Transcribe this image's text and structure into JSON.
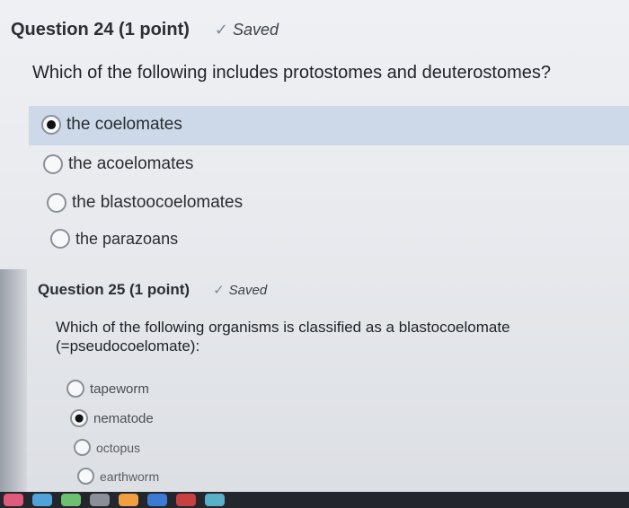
{
  "questions": [
    {
      "title": "Question 24 (1 point)",
      "saved_label": "Saved",
      "text": "Which of the following includes protostomes and deuterostomes?",
      "options": [
        {
          "label": "the coelomates",
          "selected": true
        },
        {
          "label": "the acoelomates",
          "selected": false
        },
        {
          "label": "the blastoocoelomates",
          "selected": false
        },
        {
          "label": "the parazoans",
          "selected": false
        }
      ]
    },
    {
      "title": "Question 25 (1 point)",
      "saved_label": "Saved",
      "text_line1": "Which of the following organisms is classified as a blastocoelomate",
      "text_line2": "(=pseudocoelomate):",
      "options": [
        {
          "label": "tapeworm",
          "selected": false
        },
        {
          "label": "nematode",
          "selected": true
        },
        {
          "label": "octopus",
          "selected": false
        },
        {
          "label": "earthworm",
          "selected": false
        }
      ]
    }
  ],
  "colors": {
    "selected_highlight": "#cdd9e8",
    "background": "#eef0f4"
  }
}
